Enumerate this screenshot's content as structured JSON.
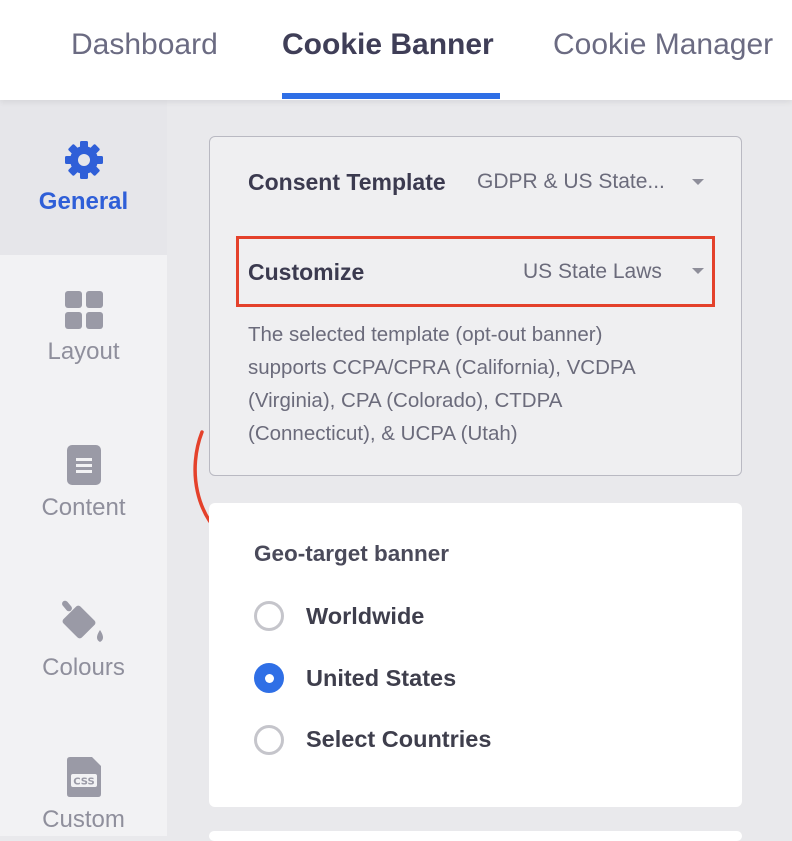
{
  "tabs": [
    {
      "label": "Dashboard",
      "active": false
    },
    {
      "label": "Cookie Banner",
      "active": true
    },
    {
      "label": "Cookie Manager",
      "active": false
    }
  ],
  "sidebar": {
    "items": [
      {
        "label": "General",
        "icon": "gear-icon",
        "active": true
      },
      {
        "label": "Layout",
        "icon": "grid-icon",
        "active": false
      },
      {
        "label": "Content",
        "icon": "document-icon",
        "active": false
      },
      {
        "label": "Colours",
        "icon": "paint-bucket-icon",
        "active": false
      },
      {
        "label": "Custom",
        "icon": "css-file-icon",
        "active": false
      }
    ]
  },
  "template_card": {
    "consent_template_label": "Consent Template",
    "consent_template_value": "GDPR & US State...",
    "customize_label": "Customize",
    "customize_value": "US State Laws",
    "description_lines": [
      "The selected template (opt-out banner)",
      "supports CCPA/CPRA (California), VCDPA",
      "(Virginia), CPA (Colorado), CTDPA",
      "(Connecticut), & UCPA (Utah)"
    ]
  },
  "geo_target": {
    "title": "Geo-target banner",
    "options": [
      {
        "label": "Worldwide",
        "selected": false
      },
      {
        "label": "United States",
        "selected": true
      },
      {
        "label": "Select Countries",
        "selected": false
      }
    ]
  },
  "colors": {
    "accent": "#2f6fe6",
    "annotation": "#e4412b",
    "sidebar_active_text": "#2f5fd8"
  }
}
